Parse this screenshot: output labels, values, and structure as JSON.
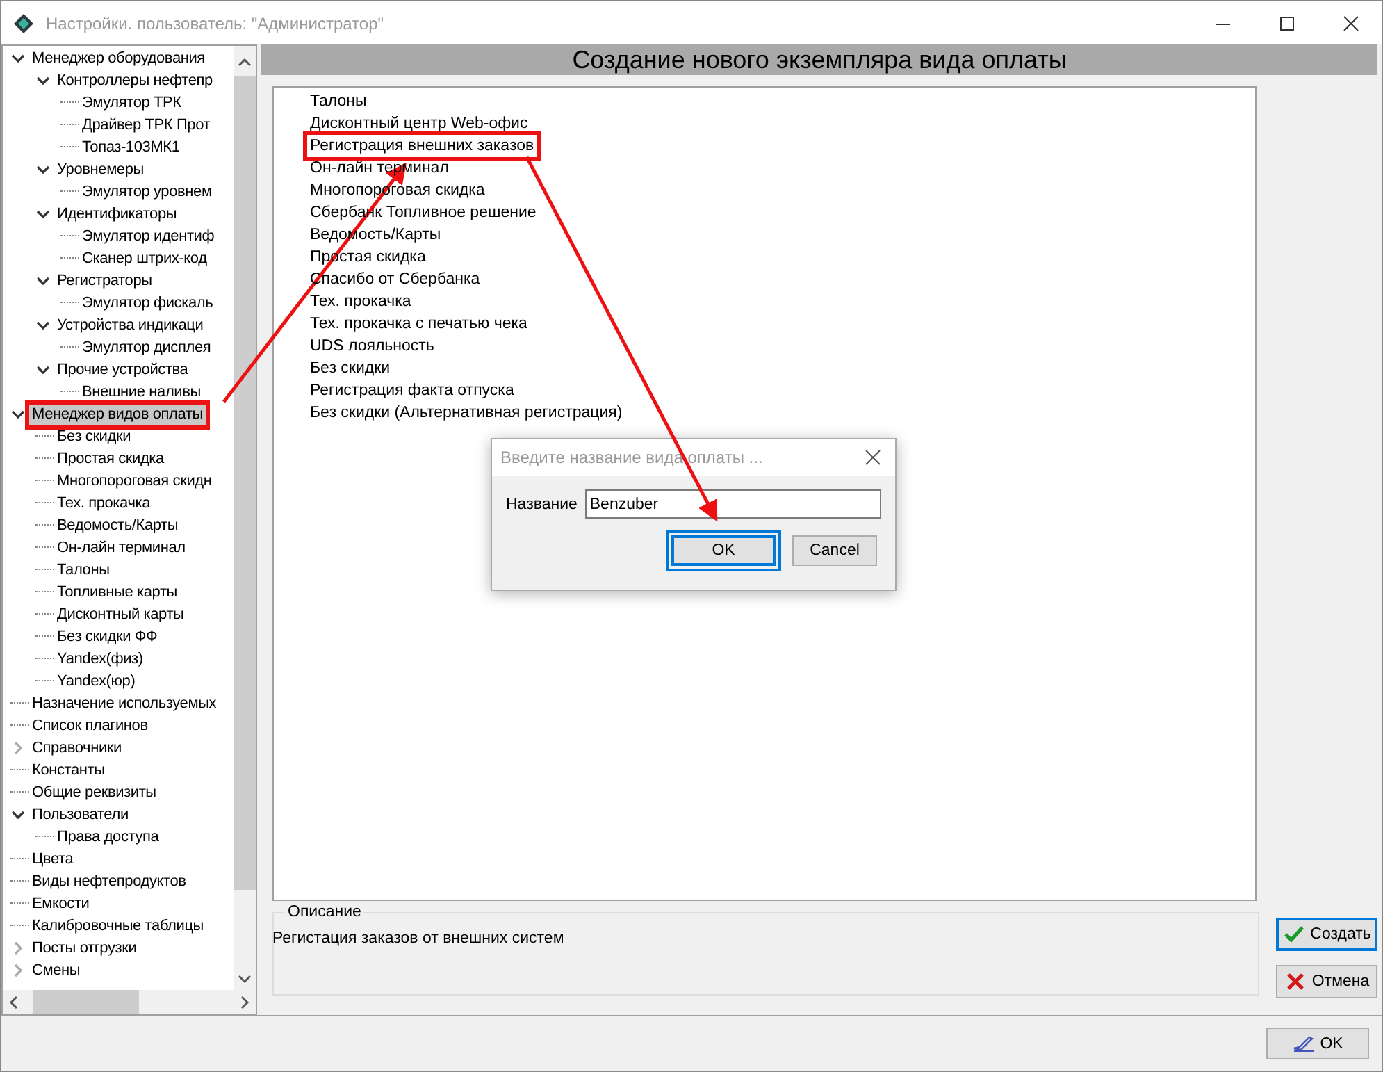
{
  "window": {
    "title": "Настройки. пользователь: \"Администратор\""
  },
  "tree": [
    {
      "label": "Менеджер оборудования",
      "expanded": true,
      "selected": false,
      "highlighted": false,
      "children": [
        {
          "label": "Контроллеры нефтепр",
          "expanded": true,
          "selected": false,
          "highlighted": false,
          "children": [
            {
              "label": "Эмулятор ТРК",
              "selected": false,
              "highlighted": false
            },
            {
              "label": "Драйвер ТРК Прот",
              "selected": false,
              "highlighted": false
            },
            {
              "label": "Топаз-103МК1",
              "selected": false,
              "highlighted": false
            }
          ]
        },
        {
          "label": "Уровнемеры",
          "expanded": true,
          "selected": false,
          "highlighted": false,
          "children": [
            {
              "label": "Эмулятор уровнем",
              "selected": false,
              "highlighted": false
            }
          ]
        },
        {
          "label": "Идентификаторы",
          "expanded": true,
          "selected": false,
          "highlighted": false,
          "children": [
            {
              "label": "Эмулятор идентиф",
              "selected": false,
              "highlighted": false
            },
            {
              "label": "Сканер штрих-код",
              "selected": false,
              "highlighted": false
            }
          ]
        },
        {
          "label": "Регистраторы",
          "expanded": true,
          "selected": false,
          "highlighted": false,
          "children": [
            {
              "label": "Эмулятор фискаль",
              "selected": false,
              "highlighted": false
            }
          ]
        },
        {
          "label": "Устройства индикаци",
          "expanded": true,
          "selected": false,
          "highlighted": false,
          "children": [
            {
              "label": "Эмулятор дисплея",
              "selected": false,
              "highlighted": false
            }
          ]
        },
        {
          "label": "Прочие устройства",
          "expanded": true,
          "selected": false,
          "highlighted": false,
          "children": [
            {
              "label": "Внешние наливы",
              "selected": false,
              "highlighted": false
            }
          ]
        }
      ]
    },
    {
      "label": "Менеджер видов оплаты",
      "expanded": true,
      "selected": true,
      "highlighted": true,
      "children": [
        {
          "label": "Без скидки",
          "selected": false,
          "highlighted": false
        },
        {
          "label": "Простая скидка",
          "selected": false,
          "highlighted": false
        },
        {
          "label": "Многопороговая скидн",
          "selected": false,
          "highlighted": false
        },
        {
          "label": "Тех. прокачка",
          "selected": false,
          "highlighted": false
        },
        {
          "label": "Ведомость/Карты",
          "selected": false,
          "highlighted": false
        },
        {
          "label": "Он-лайн терминал",
          "selected": false,
          "highlighted": false
        },
        {
          "label": "Талоны",
          "selected": false,
          "highlighted": false
        },
        {
          "label": "Топливные карты",
          "selected": false,
          "highlighted": false
        },
        {
          "label": "Дисконтный карты",
          "selected": false,
          "highlighted": false
        },
        {
          "label": "Без скидки ФФ",
          "selected": false,
          "highlighted": false
        },
        {
          "label": "Yandex(физ)",
          "selected": false,
          "highlighted": false
        },
        {
          "label": "Yandex(юр)",
          "selected": false,
          "highlighted": false
        }
      ]
    },
    {
      "label": "Назначение используемых",
      "selected": false,
      "highlighted": false
    },
    {
      "label": "Список плагинов",
      "selected": false,
      "highlighted": false
    },
    {
      "label": "Справочники",
      "expanded": false,
      "selected": false,
      "highlighted": false
    },
    {
      "label": "Константы",
      "selected": false,
      "highlighted": false
    },
    {
      "label": "Общие реквизиты",
      "selected": false,
      "highlighted": false
    },
    {
      "label": "Пользователи",
      "expanded": true,
      "selected": false,
      "highlighted": false,
      "children": [
        {
          "label": "Права доступа",
          "selected": false,
          "highlighted": false
        }
      ]
    },
    {
      "label": "Цвета",
      "selected": false,
      "highlighted": false
    },
    {
      "label": "Виды нефтепродуктов",
      "selected": false,
      "highlighted": false
    },
    {
      "label": "Емкости",
      "selected": false,
      "highlighted": false
    },
    {
      "label": "Калибровочные таблицы",
      "selected": false,
      "highlighted": false
    },
    {
      "label": "Посты отгрузки",
      "expanded": false,
      "selected": false,
      "highlighted": false
    },
    {
      "label": "Смены",
      "expanded": false,
      "selected": false,
      "highlighted": false
    }
  ],
  "panel": {
    "title": "Создание нового экземпляра вида оплаты",
    "payment_types": [
      {
        "label": "Талоны",
        "highlighted": false
      },
      {
        "label": "Дисконтный центр Web-офис",
        "highlighted": false
      },
      {
        "label": "Регистрация внешних заказов",
        "highlighted": true
      },
      {
        "label": "Он-лайн терминал",
        "highlighted": false
      },
      {
        "label": "Многопороговая скидка",
        "highlighted": false
      },
      {
        "label": "Сбербанк Топливное решение",
        "highlighted": false
      },
      {
        "label": "Ведомость/Карты",
        "highlighted": false
      },
      {
        "label": "Простая скидка",
        "highlighted": false
      },
      {
        "label": "Спасибо от Сбербанка",
        "highlighted": false
      },
      {
        "label": "Тех. прокачка",
        "highlighted": false
      },
      {
        "label": "Тех. прокачка с печатью чека",
        "highlighted": false
      },
      {
        "label": "UDS лояльность",
        "highlighted": false
      },
      {
        "label": "Без скидки",
        "highlighted": false
      },
      {
        "label": "Регистрация факта отпуска",
        "highlighted": false
      },
      {
        "label": "Без скидки (Альтернативная регистрация)",
        "highlighted": false
      }
    ],
    "description": {
      "legend": "Описание",
      "text": "Регистация заказов от внешних систем"
    },
    "buttons": [
      {
        "kind": "create",
        "label": "Создать",
        "focused": true
      },
      {
        "kind": "cancel",
        "label": "Отмена",
        "focused": false
      }
    ]
  },
  "footer": {
    "ok_button": "OK"
  },
  "dialog": {
    "title": "Введите название вида оплаты ...",
    "field_label": "Название",
    "value": "Benzuber",
    "buttons": [
      {
        "label": "OK",
        "focused": true,
        "highlighted": true
      },
      {
        "label": "Cancel",
        "focused": false,
        "highlighted": false
      }
    ]
  }
}
